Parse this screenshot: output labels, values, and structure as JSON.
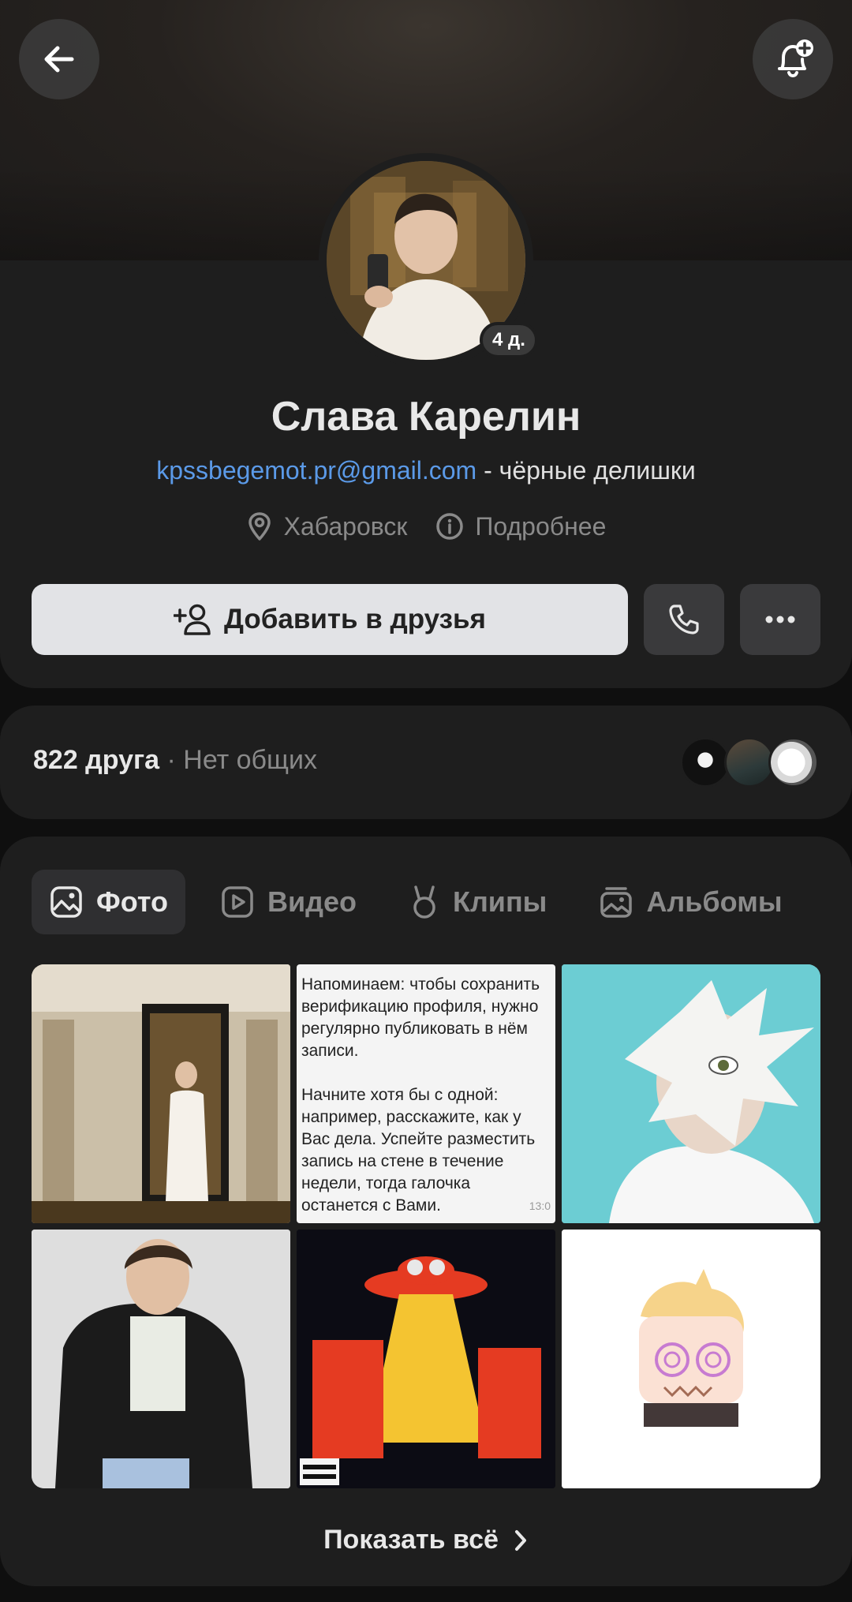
{
  "profile": {
    "name": "Слава Карелин",
    "avatar_badge": "4 д.",
    "status_link": "kpssbegemot.pr@gmail.com",
    "status_rest": " - чёрные делишки",
    "city": "Хабаровск",
    "details_label": "Подробнее"
  },
  "actions": {
    "add_friend_label": "Добавить в друзья"
  },
  "friends": {
    "count_label": "822 друга",
    "separator": " · ",
    "mutual_label": "Нет общих"
  },
  "media": {
    "tabs": [
      {
        "label": "Фото",
        "icon": "photo-icon",
        "active": true
      },
      {
        "label": "Видео",
        "icon": "video-icon",
        "active": false
      },
      {
        "label": "Клипы",
        "icon": "clips-icon",
        "active": false
      },
      {
        "label": "Альбомы",
        "icon": "albums-icon",
        "active": false
      }
    ],
    "text_photo": {
      "para1": "Напоминаем: чтобы сохранить верификацию профиля, нужно регулярно публиковать в нём записи.",
      "para2": "Начните хотя бы с одной: например, расскажите, как у Вас дела. Успейте разместить запись на стене в течение недели, тогда галочка останется с Вами.",
      "time": "13:0"
    },
    "show_all_label": "Показать всё"
  },
  "colors": {
    "accent_link": "#5b9ae8",
    "card_bg": "#1e1e1e",
    "page_bg": "#0f0f0f"
  }
}
